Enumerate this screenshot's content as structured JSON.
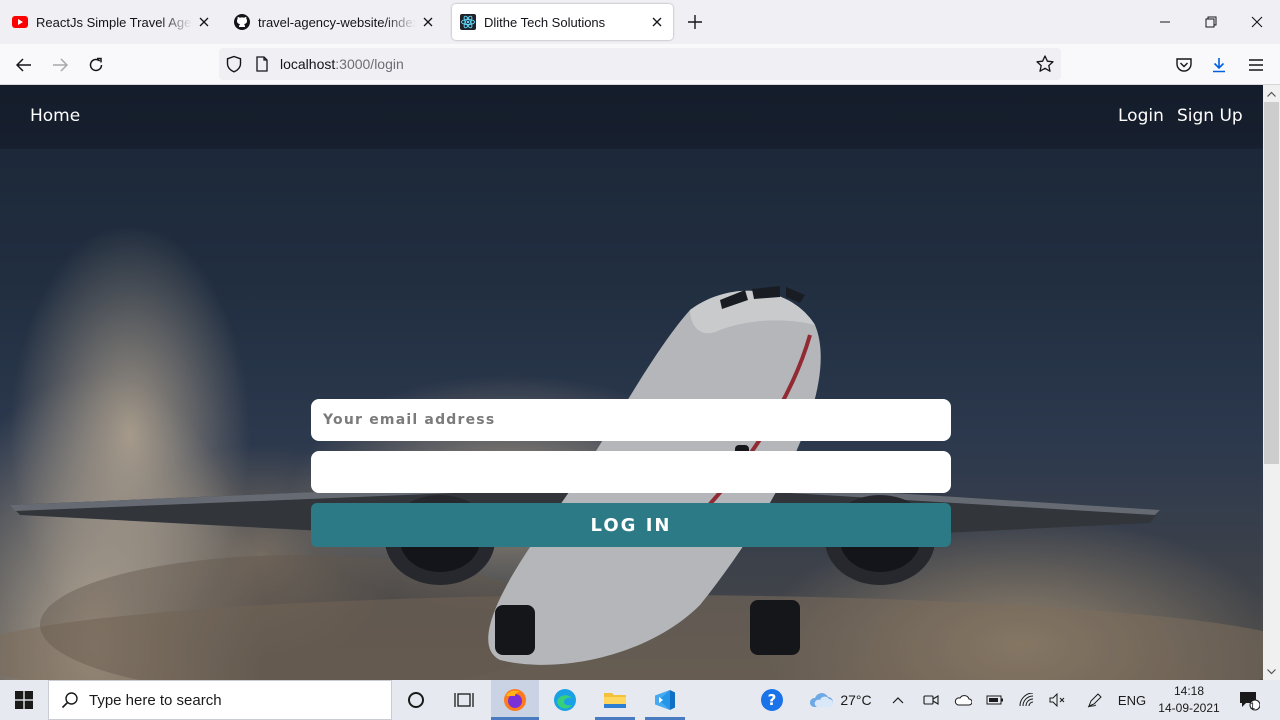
{
  "browser": {
    "tabs": [
      {
        "title": "ReactJs Simple Travel Agency La",
        "icon": "youtube-icon",
        "active": false
      },
      {
        "title": "travel-agency-website/index.css",
        "icon": "github-icon",
        "active": false
      },
      {
        "title": "Dlithe Tech Solutions",
        "icon": "react-icon",
        "active": true
      }
    ],
    "url_host": "localhost",
    "url_path": ":3000/login"
  },
  "site": {
    "nav": {
      "home": "Home",
      "login": "Login",
      "signup": "Sign Up"
    },
    "form": {
      "email_placeholder": "Your email address",
      "password_placeholder": "",
      "submit_label": "LOG IN"
    },
    "colors": {
      "button": "#2b7a85",
      "nav_text": "#ffffff"
    }
  },
  "taskbar": {
    "search_placeholder": "Type here to search",
    "weather": "27°C",
    "language": "ENG",
    "time": "14:18",
    "date": "14-09-2021",
    "notification_count": "1"
  }
}
